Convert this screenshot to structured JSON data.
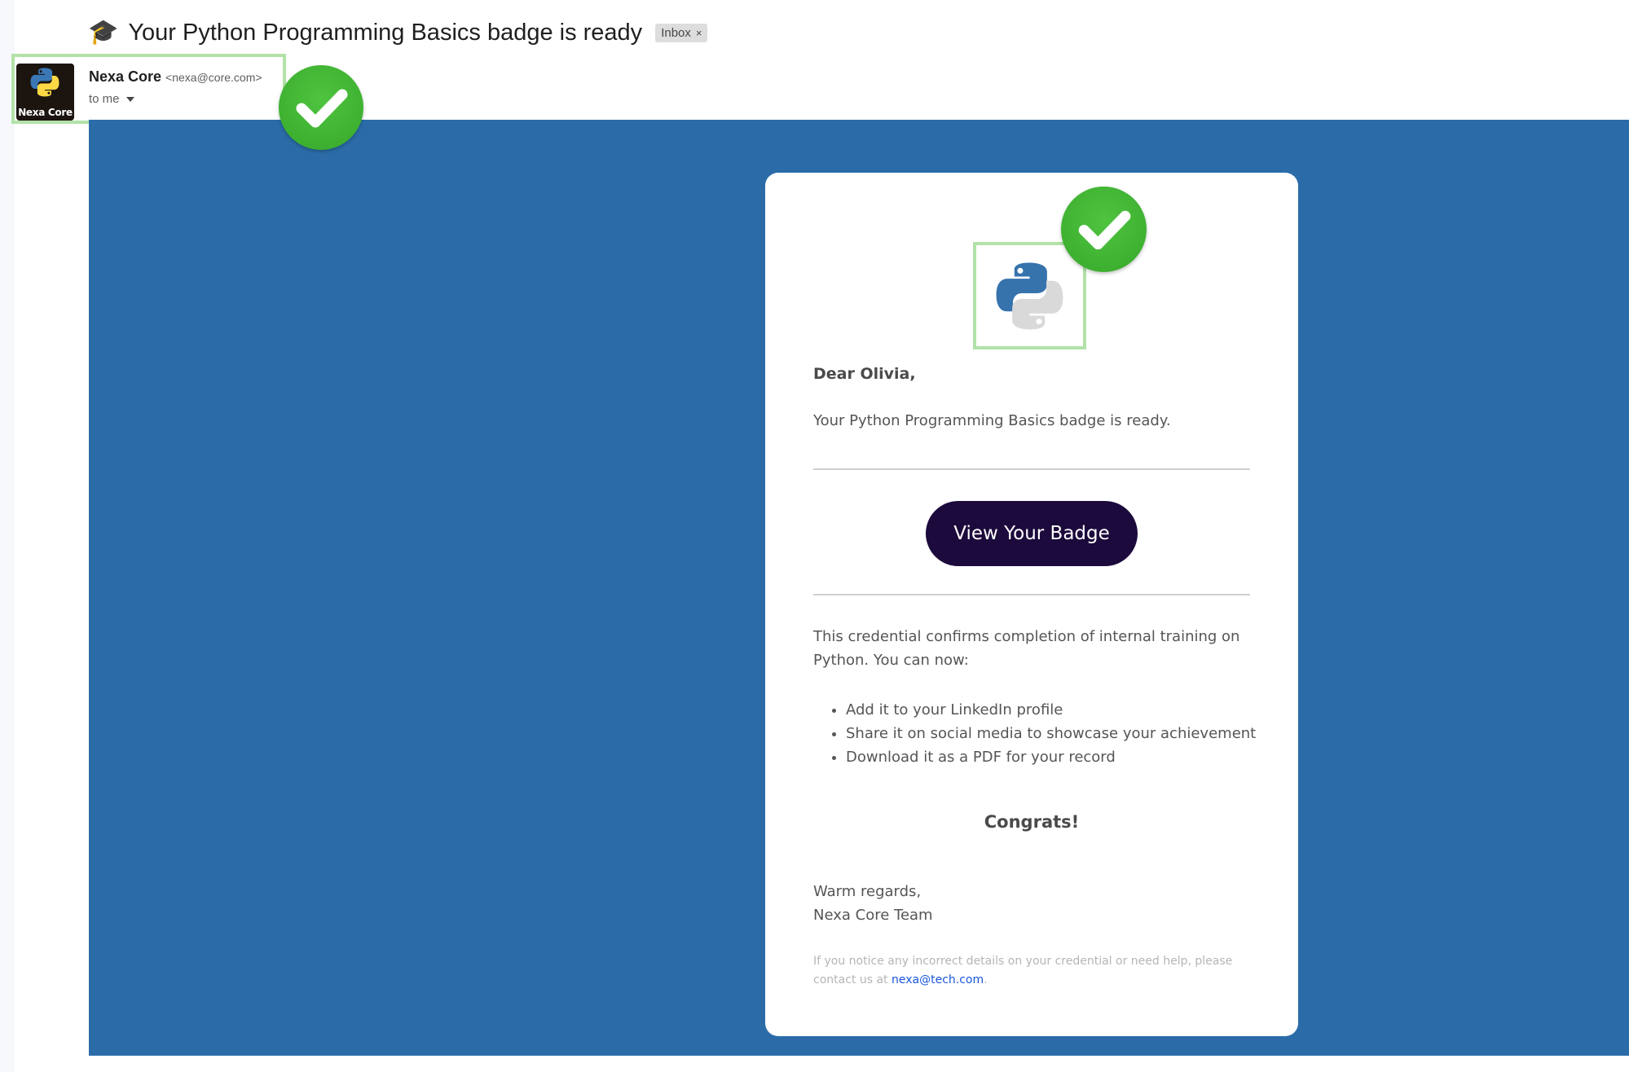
{
  "email": {
    "subject_icon": "🎓",
    "subject": "Your Python Programming Basics badge is ready",
    "label": "Inbox",
    "label_remove": "×",
    "sender": {
      "avatar_text": "Nexa Core",
      "name": "Nexa Core",
      "email": "<nexa@core.com>",
      "recipient": "to me"
    }
  },
  "card": {
    "greeting": "Dear Olivia,",
    "intro": "Your Python Programming Basics badge is ready.",
    "cta_label": "View Your Badge",
    "body": "This credential confirms completion of internal training on Python. You can now:",
    "bullets": [
      "Add it to your LinkedIn profile",
      "Share it on social media to showcase your achievement",
      "Download it as a PDF for your record"
    ],
    "congrats": "Congrats!",
    "signoff_line1": "Warm regards,",
    "signoff_line2": "Nexa Core Team",
    "footnote_text": "If you notice any incorrect details on your credential or need help, please contact us at ",
    "footnote_link": "nexa@tech.com",
    "footnote_end": "."
  },
  "icons": {
    "subject": "graduation-cap-icon",
    "avatar": "python-logo-icon",
    "checkmarks": [
      "check-circle-icon",
      "check-circle-icon"
    ],
    "label_close": "close-icon",
    "recipient_dropdown": "chevron-down-icon"
  },
  "colors": {
    "panel_blue": "#2b6ca8",
    "button_dark": "#1c0a3c",
    "check_green": "#37a82b",
    "highlight_green": "#b2e2a8",
    "link_blue": "#1a56db"
  }
}
